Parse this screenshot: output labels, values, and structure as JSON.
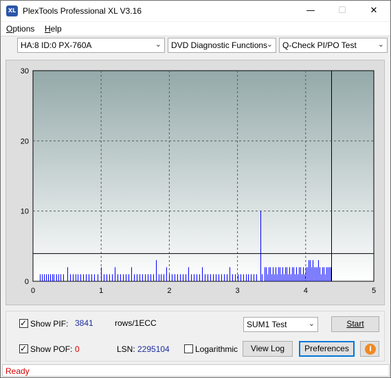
{
  "window": {
    "title": "PlexTools Professional XL V3.16",
    "icon_text": "XL",
    "minimize_glyph": "—",
    "maximize_glyph": "☐",
    "close_glyph": "✕"
  },
  "menu": {
    "items": [
      {
        "label": "Options",
        "accel": "O",
        "rest": "ptions"
      },
      {
        "label": "Help",
        "accel": "H",
        "rest": "elp"
      }
    ]
  },
  "toolbar": {
    "drive": "HA:8 ID:0  PX-760A",
    "function": "DVD Diagnostic Functions",
    "test": "Q-Check PI/PO Test"
  },
  "chart_data": {
    "type": "bar",
    "x_ticks": [
      "0",
      "1",
      "2",
      "3",
      "4",
      "5"
    ],
    "y_ticks": [
      "0",
      "10",
      "20",
      "30"
    ],
    "xlim": [
      0,
      5
    ],
    "ylim": [
      0,
      30
    ],
    "threshold_line": 4,
    "data_end_marker": 4.37,
    "grid": true,
    "series_color": "#0000ff",
    "series": [
      {
        "x": 0.1,
        "y": 1
      },
      {
        "x": 0.13,
        "y": 1
      },
      {
        "x": 0.16,
        "y": 1
      },
      {
        "x": 0.19,
        "y": 1
      },
      {
        "x": 0.22,
        "y": 1
      },
      {
        "x": 0.25,
        "y": 1
      },
      {
        "x": 0.28,
        "y": 1
      },
      {
        "x": 0.3,
        "y": 1
      },
      {
        "x": 0.34,
        "y": 1
      },
      {
        "x": 0.37,
        "y": 1
      },
      {
        "x": 0.4,
        "y": 1
      },
      {
        "x": 0.44,
        "y": 1
      },
      {
        "x": 0.5,
        "y": 2
      },
      {
        "x": 0.54,
        "y": 1
      },
      {
        "x": 0.58,
        "y": 1
      },
      {
        "x": 0.62,
        "y": 1
      },
      {
        "x": 0.66,
        "y": 1
      },
      {
        "x": 0.7,
        "y": 1
      },
      {
        "x": 0.74,
        "y": 1
      },
      {
        "x": 0.78,
        "y": 1
      },
      {
        "x": 0.82,
        "y": 1
      },
      {
        "x": 0.86,
        "y": 1
      },
      {
        "x": 0.9,
        "y": 1
      },
      {
        "x": 0.95,
        "y": 1
      },
      {
        "x": 1.0,
        "y": 2
      },
      {
        "x": 1.04,
        "y": 1
      },
      {
        "x": 1.08,
        "y": 1
      },
      {
        "x": 1.12,
        "y": 1
      },
      {
        "x": 1.16,
        "y": 1
      },
      {
        "x": 1.2,
        "y": 2
      },
      {
        "x": 1.24,
        "y": 1
      },
      {
        "x": 1.28,
        "y": 1
      },
      {
        "x": 1.32,
        "y": 1
      },
      {
        "x": 1.36,
        "y": 1
      },
      {
        "x": 1.4,
        "y": 1
      },
      {
        "x": 1.44,
        "y": 2
      },
      {
        "x": 1.48,
        "y": 1
      },
      {
        "x": 1.52,
        "y": 1
      },
      {
        "x": 1.56,
        "y": 1
      },
      {
        "x": 1.6,
        "y": 1
      },
      {
        "x": 1.64,
        "y": 1
      },
      {
        "x": 1.68,
        "y": 1
      },
      {
        "x": 1.72,
        "y": 1
      },
      {
        "x": 1.76,
        "y": 1
      },
      {
        "x": 1.8,
        "y": 3
      },
      {
        "x": 1.84,
        "y": 1
      },
      {
        "x": 1.88,
        "y": 1
      },
      {
        "x": 1.92,
        "y": 1
      },
      {
        "x": 1.96,
        "y": 2
      },
      {
        "x": 2.0,
        "y": 1
      },
      {
        "x": 2.04,
        "y": 1
      },
      {
        "x": 2.08,
        "y": 1
      },
      {
        "x": 2.12,
        "y": 1
      },
      {
        "x": 2.16,
        "y": 1
      },
      {
        "x": 2.2,
        "y": 1
      },
      {
        "x": 2.24,
        "y": 1
      },
      {
        "x": 2.28,
        "y": 2
      },
      {
        "x": 2.32,
        "y": 1
      },
      {
        "x": 2.36,
        "y": 1
      },
      {
        "x": 2.4,
        "y": 1
      },
      {
        "x": 2.44,
        "y": 1
      },
      {
        "x": 2.48,
        "y": 2
      },
      {
        "x": 2.52,
        "y": 1
      },
      {
        "x": 2.56,
        "y": 1
      },
      {
        "x": 2.6,
        "y": 1
      },
      {
        "x": 2.64,
        "y": 1
      },
      {
        "x": 2.68,
        "y": 1
      },
      {
        "x": 2.72,
        "y": 1
      },
      {
        "x": 2.76,
        "y": 1
      },
      {
        "x": 2.8,
        "y": 1
      },
      {
        "x": 2.84,
        "y": 1
      },
      {
        "x": 2.88,
        "y": 2
      },
      {
        "x": 2.92,
        "y": 1
      },
      {
        "x": 2.96,
        "y": 1
      },
      {
        "x": 3.0,
        "y": 1
      },
      {
        "x": 3.04,
        "y": 1
      },
      {
        "x": 3.08,
        "y": 1
      },
      {
        "x": 3.12,
        "y": 1
      },
      {
        "x": 3.16,
        "y": 1
      },
      {
        "x": 3.2,
        "y": 1
      },
      {
        "x": 3.24,
        "y": 1
      },
      {
        "x": 3.28,
        "y": 1
      },
      {
        "x": 3.34,
        "y": 10
      },
      {
        "x": 3.36,
        "y": 1
      },
      {
        "x": 3.4,
        "y": 2
      },
      {
        "x": 3.42,
        "y": 2
      },
      {
        "x": 3.44,
        "y": 1
      },
      {
        "x": 3.46,
        "y": 2
      },
      {
        "x": 3.48,
        "y": 2
      },
      {
        "x": 3.5,
        "y": 1
      },
      {
        "x": 3.52,
        "y": 2
      },
      {
        "x": 3.54,
        "y": 1
      },
      {
        "x": 3.56,
        "y": 2
      },
      {
        "x": 3.58,
        "y": 1
      },
      {
        "x": 3.6,
        "y": 2
      },
      {
        "x": 3.62,
        "y": 2
      },
      {
        "x": 3.64,
        "y": 1
      },
      {
        "x": 3.66,
        "y": 2
      },
      {
        "x": 3.68,
        "y": 1
      },
      {
        "x": 3.7,
        "y": 2
      },
      {
        "x": 3.72,
        "y": 2
      },
      {
        "x": 3.74,
        "y": 1
      },
      {
        "x": 3.76,
        "y": 2
      },
      {
        "x": 3.78,
        "y": 1
      },
      {
        "x": 3.8,
        "y": 2
      },
      {
        "x": 3.82,
        "y": 2
      },
      {
        "x": 3.84,
        "y": 1
      },
      {
        "x": 3.86,
        "y": 2
      },
      {
        "x": 3.88,
        "y": 1
      },
      {
        "x": 3.9,
        "y": 2
      },
      {
        "x": 3.92,
        "y": 2
      },
      {
        "x": 3.94,
        "y": 1
      },
      {
        "x": 3.96,
        "y": 2
      },
      {
        "x": 3.98,
        "y": 1
      },
      {
        "x": 4.0,
        "y": 2
      },
      {
        "x": 4.02,
        "y": 2
      },
      {
        "x": 4.04,
        "y": 3
      },
      {
        "x": 4.06,
        "y": 3
      },
      {
        "x": 4.08,
        "y": 2
      },
      {
        "x": 4.1,
        "y": 3
      },
      {
        "x": 4.12,
        "y": 2
      },
      {
        "x": 4.14,
        "y": 2
      },
      {
        "x": 4.16,
        "y": 2
      },
      {
        "x": 4.18,
        "y": 3
      },
      {
        "x": 4.2,
        "y": 2
      },
      {
        "x": 4.22,
        "y": 1
      },
      {
        "x": 4.24,
        "y": 2
      },
      {
        "x": 4.26,
        "y": 2
      },
      {
        "x": 4.28,
        "y": 1
      },
      {
        "x": 4.3,
        "y": 2
      },
      {
        "x": 4.32,
        "y": 2
      },
      {
        "x": 4.34,
        "y": 2
      },
      {
        "x": 4.36,
        "y": 2
      }
    ]
  },
  "bottom": {
    "show_pif_label": "Show PIF:",
    "show_pif_accel": "I",
    "pif_value": "3841",
    "rows_label": "rows/1ECC",
    "show_pof_label": "Show POF:",
    "pof_value": "0",
    "lsn_label": "LSN:",
    "lsn_value": "2295104",
    "logarithmic_label": "Logarithmic",
    "sum_test": "SUM1 Test",
    "start_label": "Start",
    "view_log_label": "View Log",
    "preferences_label": "Preferences",
    "info_glyph": "i",
    "check_glyph": "✓"
  },
  "status": {
    "text": "Ready"
  }
}
